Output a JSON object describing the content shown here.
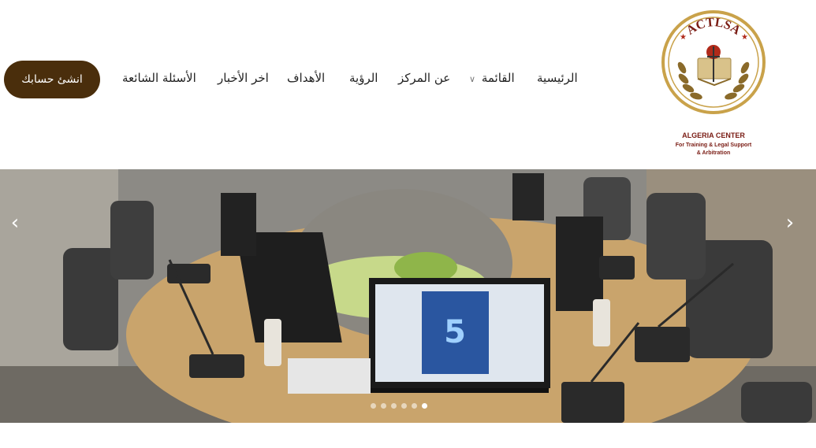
{
  "header": {
    "cta_label": "انشئ حسابك",
    "nav": [
      {
        "label": "الرئيسية"
      },
      {
        "label": "القائمة",
        "dropdown": true
      },
      {
        "label": "عن المركز"
      },
      {
        "label": "الرؤية"
      },
      {
        "label": "الأهداف"
      },
      {
        "label": "اخر الأخبار"
      },
      {
        "label": "الأسئلة الشائعة"
      }
    ]
  },
  "logo": {
    "acronym": "ACTLSA",
    "name_line1": "ALGERIA CENTER",
    "name_line2": "For Training & Legal Support",
    "name_line3": "& Arbitration"
  },
  "carousel": {
    "prev_icon": "chevron-left-icon",
    "next_icon": "chevron-right-icon",
    "slide_count": 6,
    "active_slide": 6,
    "screen_number": "5"
  },
  "colors": {
    "cta_bg": "#4a2e0c",
    "logo_ring": "#c9a24a",
    "logo_text": "#7a1c14",
    "table_wood": "#c9a46c"
  }
}
